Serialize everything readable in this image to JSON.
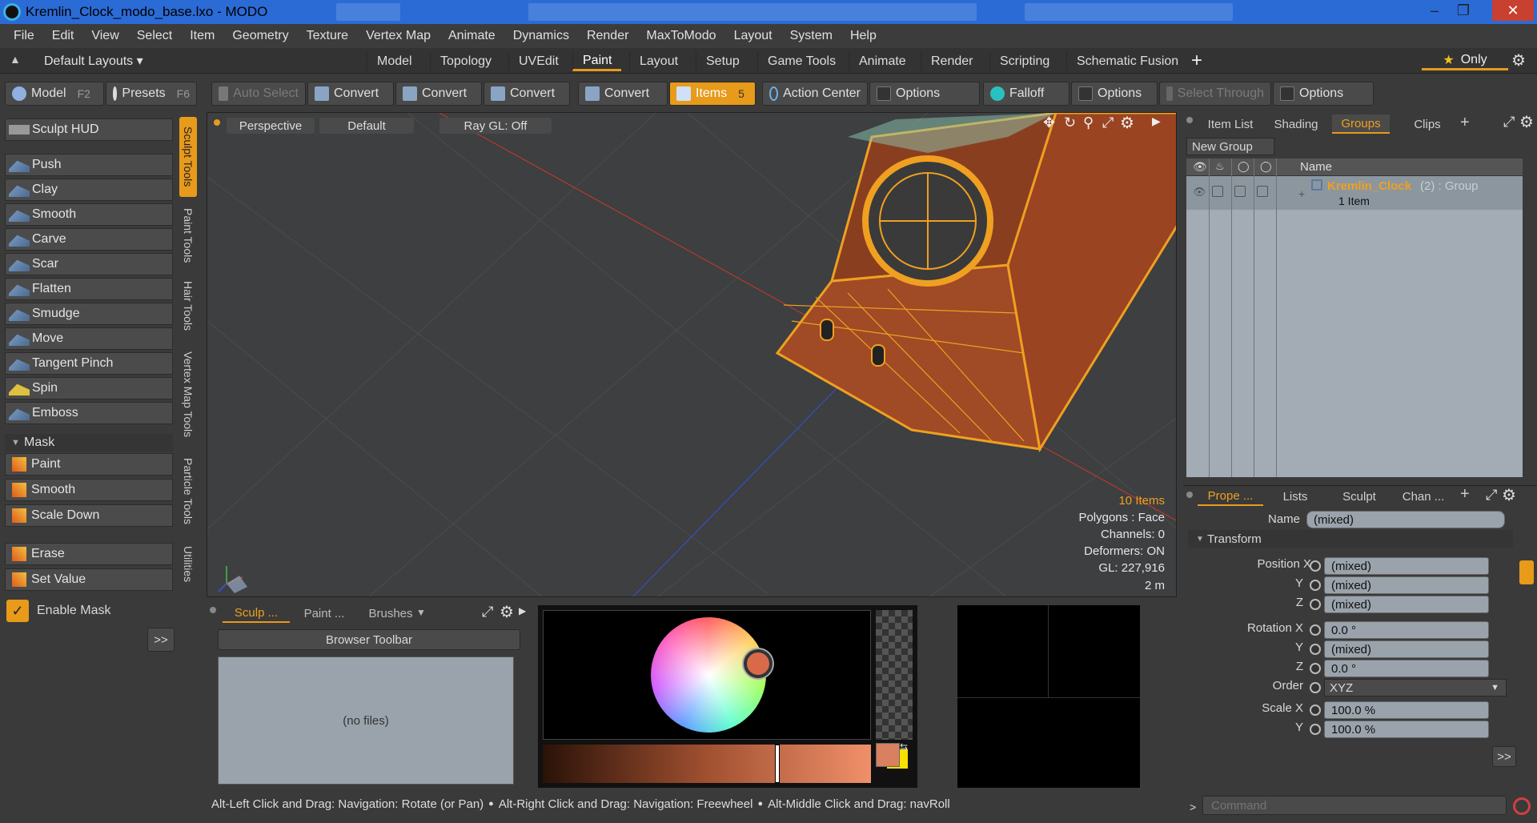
{
  "window": {
    "title": "Kremlin_Clock_modo_base.lxo - MODO"
  },
  "menu": [
    "File",
    "Edit",
    "View",
    "Select",
    "Item",
    "Geometry",
    "Texture",
    "Vertex Map",
    "Animate",
    "Dynamics",
    "Render",
    "MaxToModo",
    "Layout",
    "System",
    "Help"
  ],
  "layout_selector": "Default Layouts",
  "layout_tabs": [
    "Model",
    "Topology",
    "UVEdit",
    "Paint",
    "Layout",
    "Setup",
    "Game Tools",
    "Animate",
    "Render",
    "Scripting",
    "Schematic Fusion"
  ],
  "active_layout_tab": "Paint",
  "only_label": "Only",
  "toolbar": {
    "model": "Model",
    "model_key": "F2",
    "presets": "Presets",
    "presets_key": "F6",
    "auto_select": "Auto Select",
    "convert1": "Convert",
    "convert2": "Convert",
    "convert3": "Convert",
    "convert4": "Convert",
    "items": "Items",
    "items_key": "5",
    "action_center": "Action Center",
    "options1": "Options",
    "falloff": "Falloff",
    "options2": "Options",
    "select_through": "Select Through",
    "options3": "Options"
  },
  "sculpt": {
    "hud": "Sculpt HUD",
    "tools": [
      "Push",
      "Clay",
      "Smooth",
      "Carve",
      "Scar",
      "Flatten",
      "Smudge",
      "Move",
      "Tangent Pinch",
      "Spin",
      "Emboss"
    ],
    "mask_header": "Mask",
    "mask_tools": [
      "Paint",
      "Smooth",
      "Scale Down"
    ],
    "value_tools": [
      "Erase",
      "Set Value"
    ],
    "enable_mask": "Enable Mask",
    "more": ">>"
  },
  "vertical_tabs": [
    "Sculpt Tools",
    "Paint Tools",
    "Hair Tools",
    "Vertex Map Tools",
    "Particle Tools",
    "Utilities"
  ],
  "viewport": {
    "view": "Perspective",
    "shading": "Default",
    "raygl": "Ray GL: Off",
    "items_count": "10 Items",
    "polygons": "Polygons : Face",
    "channels": "Channels: 0",
    "deformers": "Deformers: ON",
    "gl": "GL: 227,916",
    "scale": "2 m"
  },
  "browser": {
    "tabs": [
      "Sculp ...",
      "Paint ...",
      "Brushes"
    ],
    "toolbar": "Browser Toolbar",
    "empty": "(no files)"
  },
  "colors": {
    "accent": "#e89a1a",
    "object": "#f0a020",
    "swatch_fg": "#d98060",
    "swatch_bg": "#f5e000"
  },
  "items_panel": {
    "tabs": [
      "Item List",
      "Shading",
      "Groups",
      "Clips"
    ],
    "active": "Groups",
    "new_group": "New Group",
    "name_col": "Name",
    "group_name": "Kremlin_Clock",
    "group_suffix": "(2) : Group",
    "group_sub": "1 Item"
  },
  "props_panel": {
    "tabs": [
      "Prope ...",
      "Lists",
      "Sculpt",
      "Chan ..."
    ],
    "name_label": "Name",
    "name_value": "(mixed)",
    "transform": "Transform",
    "rows": [
      {
        "label": "Position X",
        "value": "(mixed)"
      },
      {
        "label": "Y",
        "value": "(mixed)"
      },
      {
        "label": "Z",
        "value": "(mixed)"
      },
      {
        "label": "Rotation X",
        "value": "0.0 °"
      },
      {
        "label": "Y",
        "value": "(mixed)"
      },
      {
        "label": "Z",
        "value": "0.0 °"
      },
      {
        "label": "Order",
        "value": "XYZ"
      },
      {
        "label": "Scale X",
        "value": "100.0 %"
      },
      {
        "label": "Y",
        "value": "100.0 %"
      }
    ],
    "more": ">>"
  },
  "status": {
    "s1": "Alt-Left Click and Drag: Navigation: Rotate (or Pan)",
    "s2": "Alt-Right Click and Drag: Navigation: Freewheel",
    "s3": "Alt-Middle Click and Drag: navRoll"
  },
  "command_placeholder": "Command"
}
